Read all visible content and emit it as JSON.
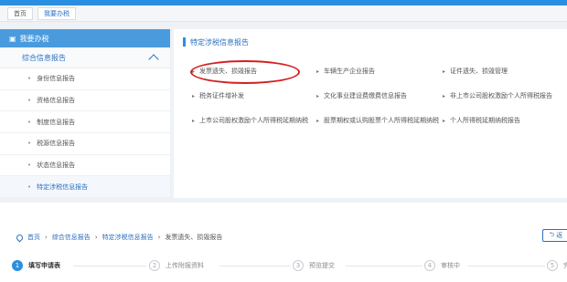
{
  "breadcrumb_top": {
    "home": "首页",
    "current": "我要办税"
  },
  "sidebar": {
    "title": "我要办税",
    "group": "综合信息报告",
    "items": [
      {
        "label": "身份信息报告"
      },
      {
        "label": "资格信息报告"
      },
      {
        "label": "制度信息报告"
      },
      {
        "label": "税源信息报告"
      },
      {
        "label": "状态信息报告"
      },
      {
        "label": "特定涉税信息报告"
      }
    ]
  },
  "main": {
    "title": "特定涉税信息报告",
    "links": [
      {
        "label": "发票遗失、损毁报告",
        "highlighted": true
      },
      {
        "label": "车辆生产企业报告"
      },
      {
        "label": "证件遗失、损毁管理"
      },
      {
        "label": "税务证件增补发"
      },
      {
        "label": "文化事业建设费缴费信息报告"
      },
      {
        "label": "非上市公司股权激励个人所得税报告"
      },
      {
        "label": "上市公司股权激励个人所得税延期纳税"
      },
      {
        "label": "股票期权或认购股票个人所得税延期纳税"
      },
      {
        "label": "个人所得税延期纳税报告"
      }
    ]
  },
  "breadcrumb_bottom": {
    "home": "首页",
    "level1": "综合信息报告",
    "level2": "特定涉税信息报告",
    "current": "发票遗失、损毁报告",
    "separator": "›",
    "back_label": "返"
  },
  "steps": [
    {
      "num": "1",
      "label": "填写申请表",
      "active": true
    },
    {
      "num": "2",
      "label": "上传附报资料"
    },
    {
      "num": "3",
      "label": "预览提交"
    },
    {
      "num": "4",
      "label": "审核中"
    },
    {
      "num": "5",
      "label": "完"
    }
  ],
  "colors": {
    "accent": "#2a8fe0",
    "highlight_circle": "#d42020"
  }
}
